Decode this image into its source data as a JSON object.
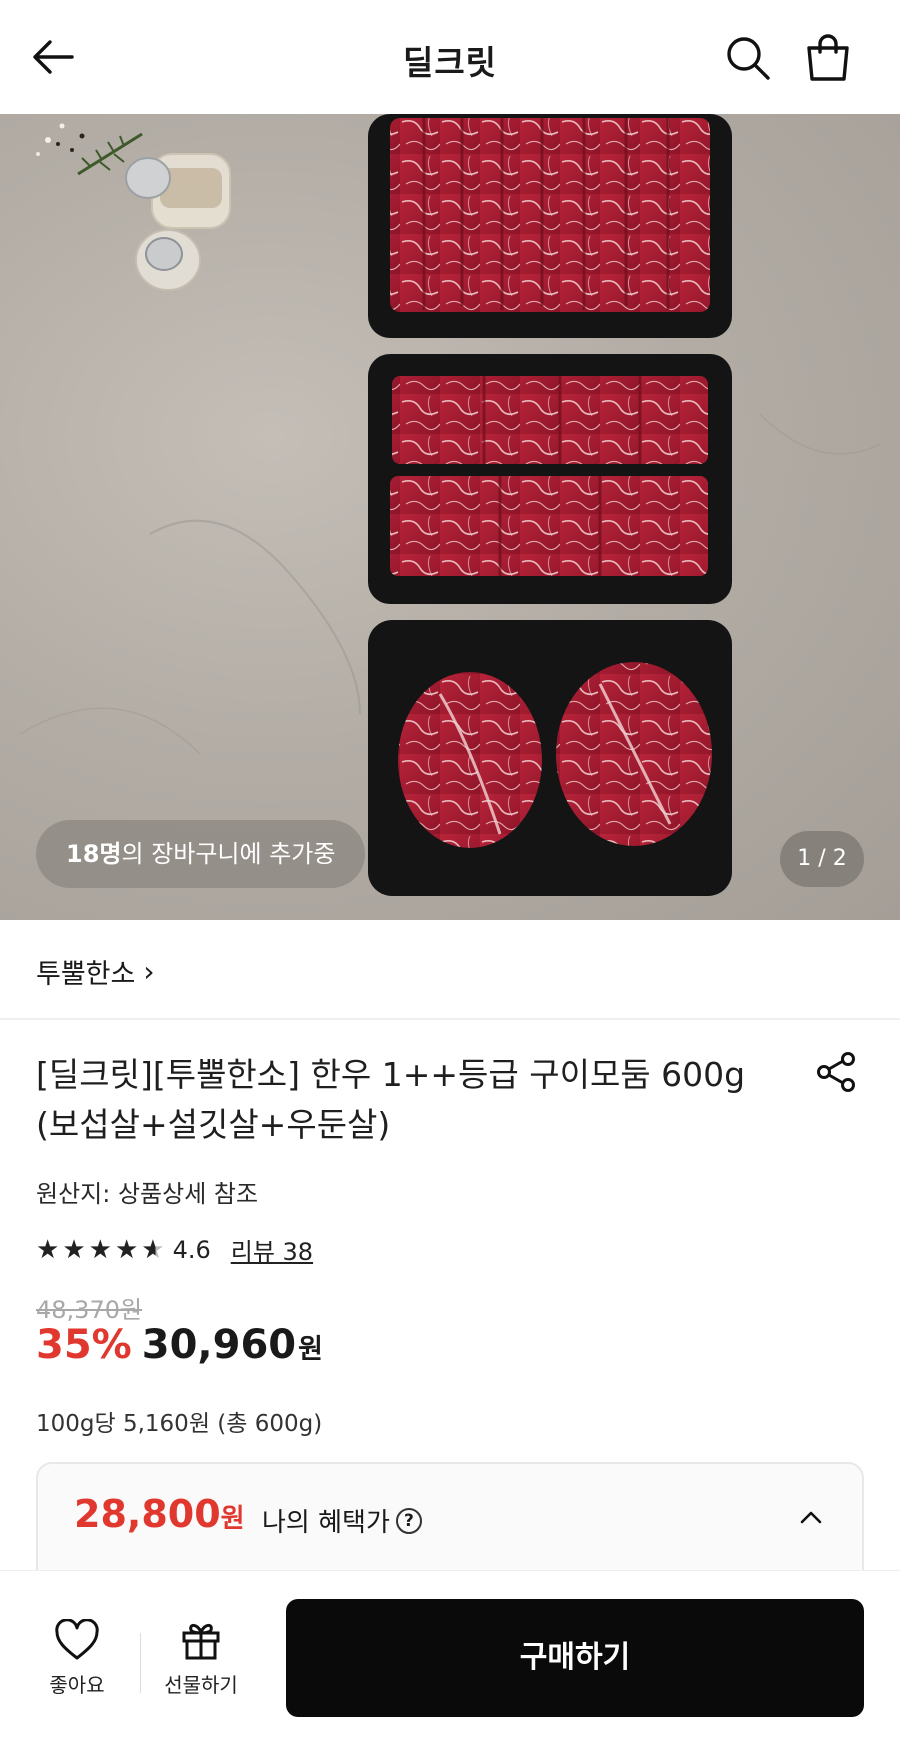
{
  "header": {
    "title": "딜크릿",
    "back_icon": "arrow-left-icon",
    "search_icon": "search-icon",
    "cart_icon": "shopping-bag-icon"
  },
  "hero": {
    "cart_count": "18명",
    "cart_text": "의 장바구니에 추가중",
    "page_indicator": "1 / 2"
  },
  "seller": {
    "name": "투뿔한소",
    "chevron": "›"
  },
  "product": {
    "title": "[딜크릿][투뿔한소] 한우 1++등급 구이모둠 600g (보섭살+설깃살+우둔살)",
    "origin": "원산지: 상품상세 참조",
    "rating": 4.6,
    "rating_text": "4.6",
    "review": "리뷰 38",
    "original_price": "48,370원",
    "discount": "35%",
    "price": "30,960",
    "price_unit": "원",
    "unit_price": "100g당 5,160원 (총 600g)"
  },
  "benefit": {
    "price": "28,800",
    "price_unit": "원",
    "label": "나의 혜택가",
    "help": "?"
  },
  "bottom": {
    "like_label": "좋아요",
    "gift_label": "선물하기",
    "buy_label": "구매하기"
  },
  "colors": {
    "accent_red": "#e0382f",
    "buy_button": "#0a0a0a",
    "strike_gray": "#a8a8a8"
  }
}
